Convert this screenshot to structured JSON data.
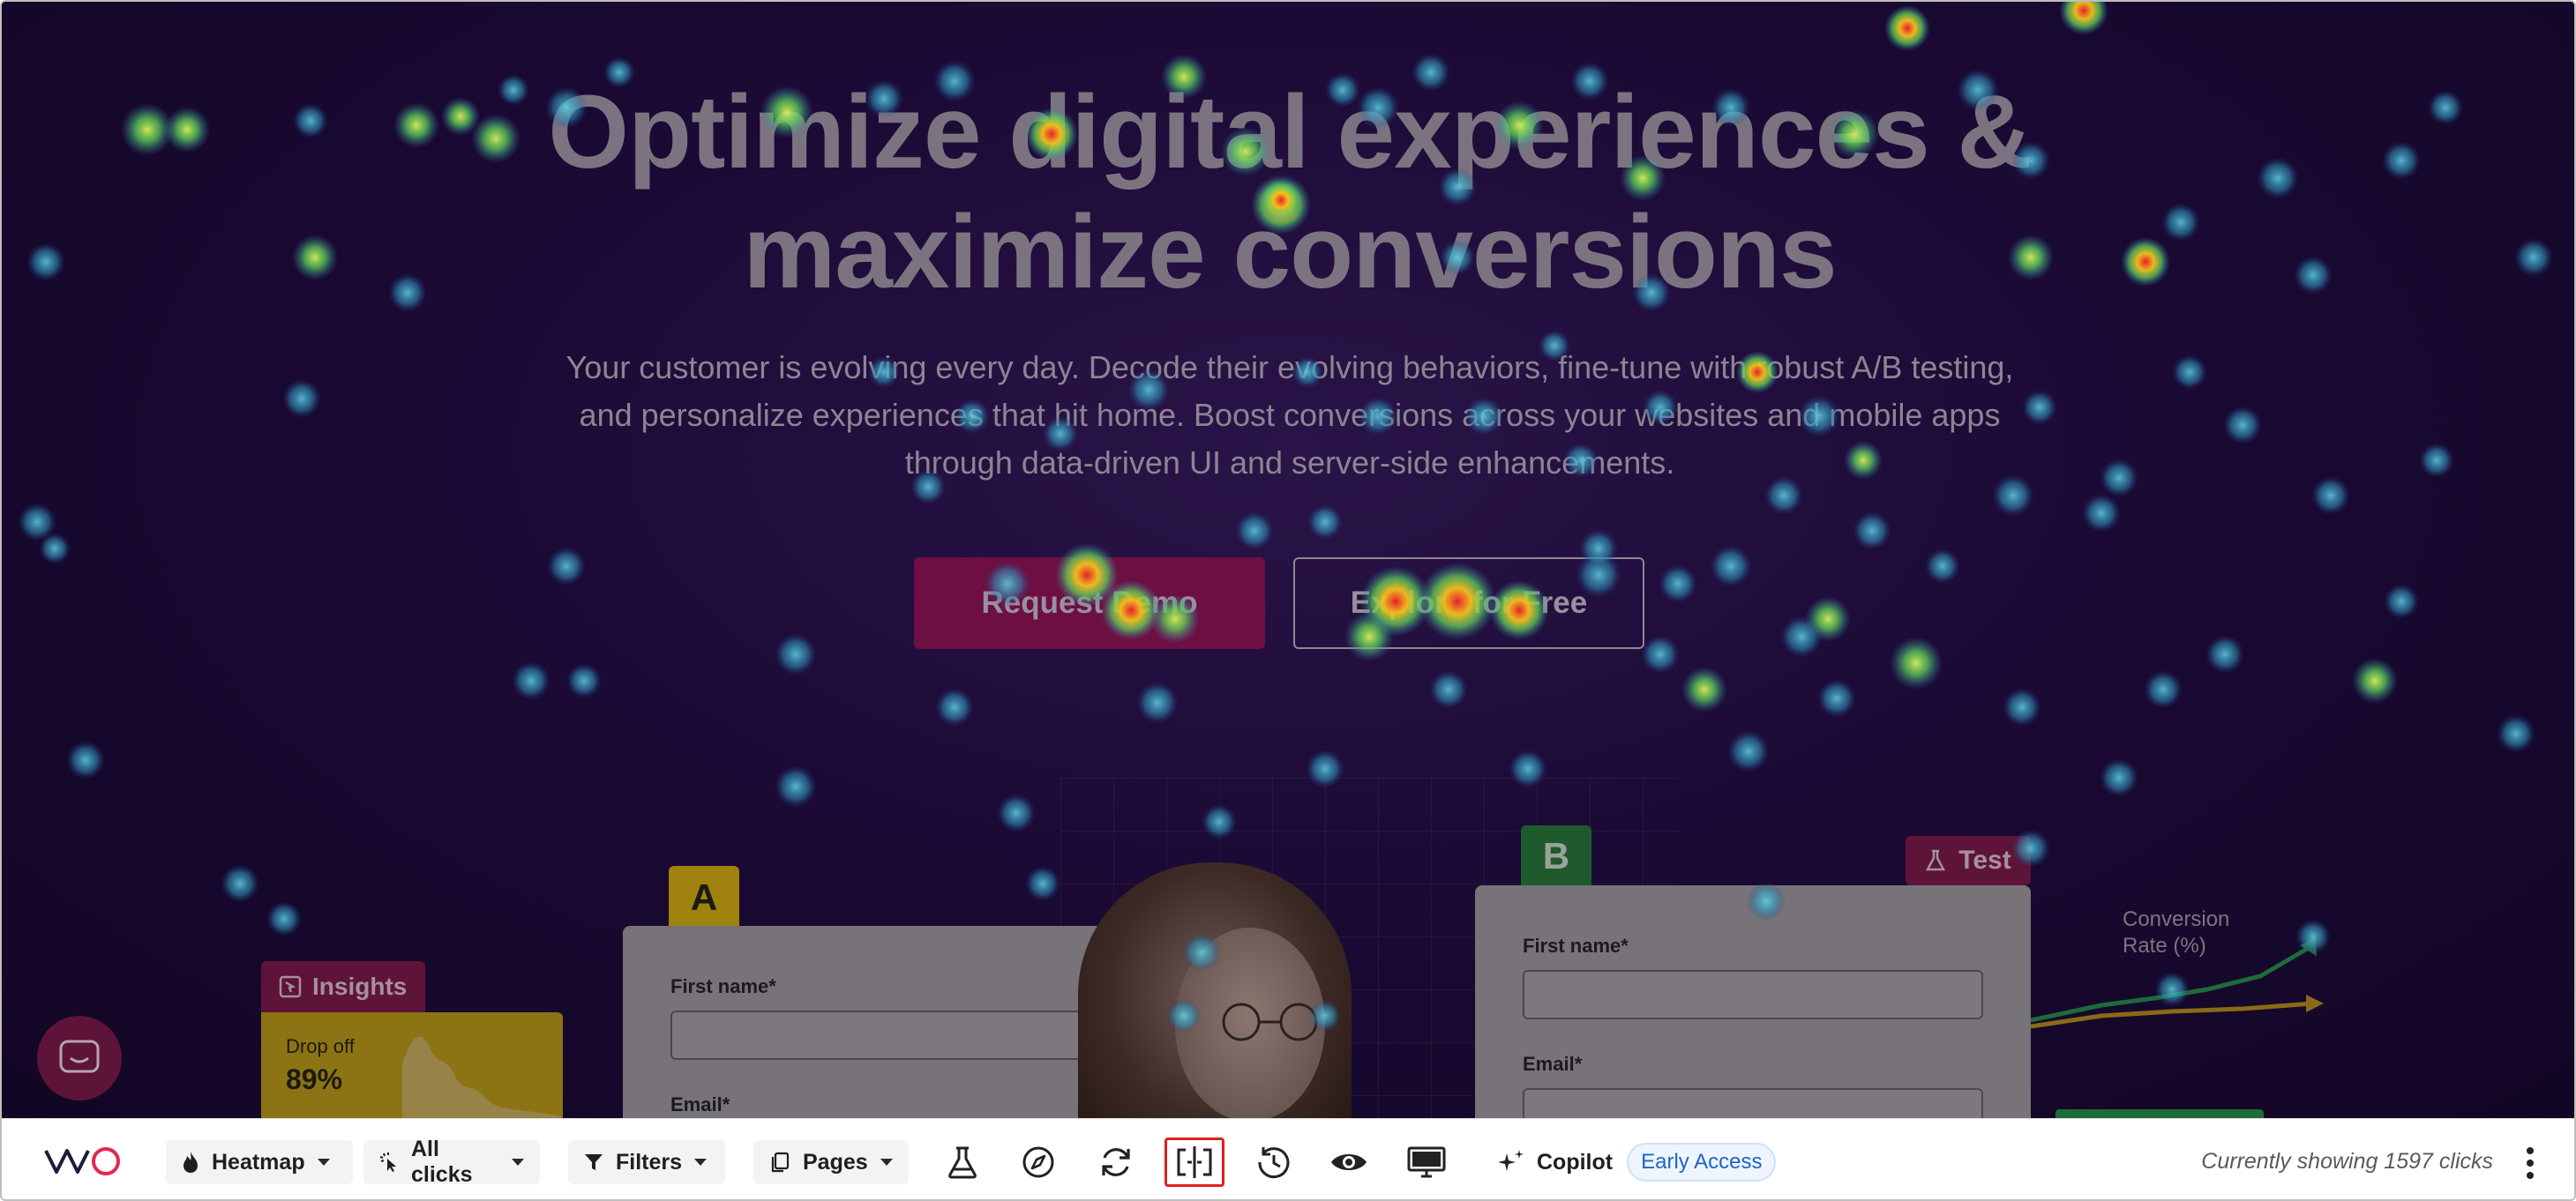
{
  "hero": {
    "title_line1": "Optimize digital experiences &",
    "title_line2": "maximize conversions",
    "subtitle_line1": "Your customer is evolving every day. Decode their evolving behaviors, fine-tune with robust A/B testing,",
    "subtitle_line2": "and personalize experiences that hit home. Boost conversions across your websites and mobile apps",
    "subtitle_line3": "through data-driven UI and server-side enhancements.",
    "cta_primary": "Request Demo",
    "cta_secondary": "Explore for Free"
  },
  "illustration": {
    "variant_a": "A",
    "variant_b": "B",
    "test_tag": "Test",
    "insights_tag": "Insights",
    "insights_metric_label": "Drop off",
    "insights_metric_value": "89%",
    "form_first_name": "First name*",
    "form_email": "Email*",
    "conversion_label_line1": "Conversion",
    "conversion_label_line2": "Rate (%)"
  },
  "toolbar": {
    "logo": "VWO",
    "heatmap_label": "Heatmap",
    "clicks_label": "All clicks",
    "filters_label": "Filters",
    "pages_label": "Pages",
    "icons": [
      "flask-icon",
      "navigation-icon",
      "refresh-icon",
      "split-view-icon",
      "history-icon",
      "eye-icon",
      "desktop-icon"
    ],
    "selected_icon": "split-view-icon",
    "copilot_label": "Copilot",
    "copilot_badge": "Early Access",
    "status_text": "Currently showing 1597 clicks"
  },
  "colors": {
    "accent_red": "#e0201e",
    "badge_blue": "#1f63c6",
    "overlay_bg": "#1b0a35"
  }
}
